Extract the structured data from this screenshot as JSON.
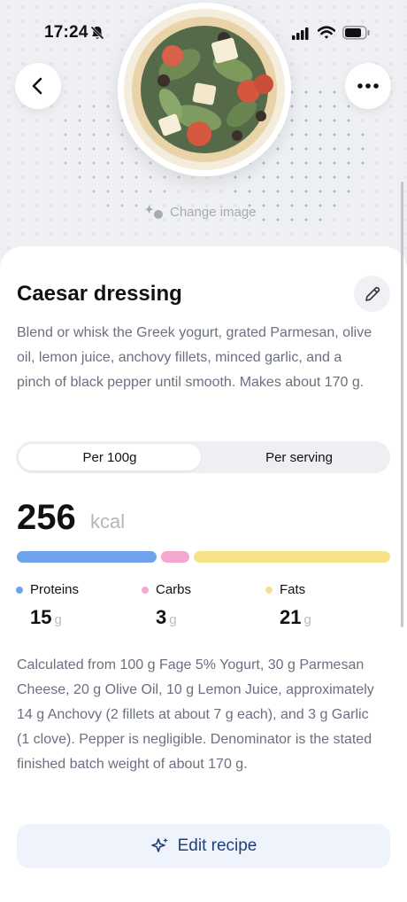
{
  "status_bar": {
    "time": "17:24"
  },
  "header": {
    "change_image_label": "Change image"
  },
  "recipe": {
    "title": "Caesar dressing",
    "description": "Blend or whisk the Greek yogurt, grated Parmesan, olive oil, lemon juice, anchovy fillets, minced garlic, and a pinch of black pepper until smooth. Makes about 170 g."
  },
  "toggle": {
    "options": [
      "Per 100g",
      "Per serving"
    ],
    "selected": "Per 100g"
  },
  "nutrition": {
    "kcal_value": "256",
    "kcal_unit": "kcal",
    "macros": [
      {
        "label": "Proteins",
        "value": "15",
        "unit": "g",
        "color": "#6fa2ec"
      },
      {
        "label": "Carbs",
        "value": "3",
        "unit": "g",
        "color": "#f2a8cf"
      },
      {
        "label": "Fats",
        "value": "21",
        "unit": "g",
        "color": "#f7e18a"
      }
    ],
    "note": "Calculated from 100 g Fage 5% Yogurt, 30 g Parmesan Cheese, 20 g Olive Oil, 10 g Lemon Juice, approximately 14 g Anchovy (2 fillets at about 7 g each), and 3 g Garlic (1 clove). Pepper is negligible. Denominator is the stated finished batch weight of about 170 g."
  },
  "actions": {
    "edit_recipe_label": "Edit recipe"
  },
  "colors": {
    "accent": "#1f3f7a",
    "button_bg": "#eef3fc",
    "muted_text": "#6b7080"
  }
}
